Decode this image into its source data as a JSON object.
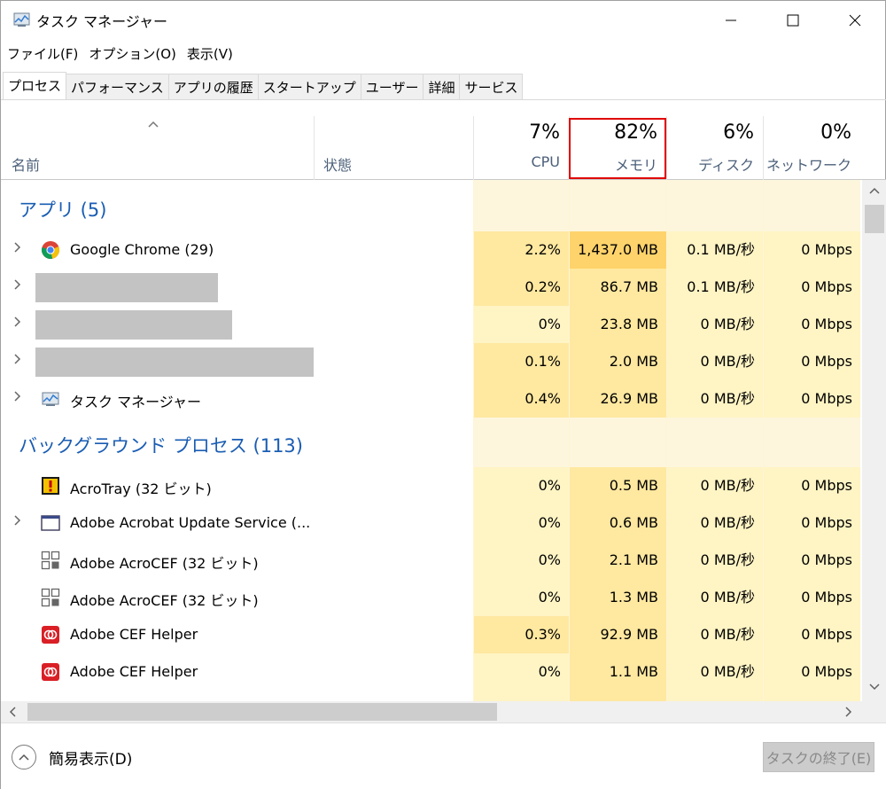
{
  "window": {
    "title": "タスク マネージャー",
    "icon": "task-manager-icon",
    "controls": {
      "minimize": "─",
      "maximize": "☐",
      "close": "✕"
    }
  },
  "menu": [
    "ファイル(F)",
    "オプション(O)",
    "表示(V)"
  ],
  "tabs": [
    {
      "label": "プロセス",
      "active": true
    },
    {
      "label": "パフォーマンス",
      "active": false
    },
    {
      "label": "アプリの履歴",
      "active": false
    },
    {
      "label": "スタートアップ",
      "active": false
    },
    {
      "label": "ユーザー",
      "active": false
    },
    {
      "label": "詳細",
      "active": false
    },
    {
      "label": "サービス",
      "active": false
    }
  ],
  "header": {
    "sort_arrow": "^",
    "name": "名前",
    "status": "状態",
    "cpu": {
      "pct": "7%",
      "label": "CPU"
    },
    "memory": {
      "pct": "82%",
      "label": "メモリ"
    },
    "disk": {
      "pct": "6%",
      "label": "ディスク"
    },
    "network": {
      "pct": "0%",
      "label": "ネットワーク"
    }
  },
  "groups": {
    "apps": "アプリ (5)",
    "background": "バックグラウンド プロセス (113)"
  },
  "apps": [
    {
      "name": "Google Chrome (29)",
      "icon": "chrome-icon",
      "expandable": true,
      "cpu": "2.2%",
      "mem": "1,437.0 MB",
      "disk": "0.1 MB/秒",
      "net": "0 Mbps"
    },
    {
      "name": "",
      "redacted": true,
      "expandable": true,
      "cpu": "0.2%",
      "mem": "86.7 MB",
      "disk": "0.1 MB/秒",
      "net": "0 Mbps"
    },
    {
      "name": "",
      "redacted": true,
      "expandable": true,
      "cpu": "0%",
      "mem": "23.8 MB",
      "disk": "0 MB/秒",
      "net": "0 Mbps"
    },
    {
      "name": "",
      "redacted": true,
      "expandable": true,
      "cpu": "0.1%",
      "mem": "2.0 MB",
      "disk": "0 MB/秒",
      "net": "0 Mbps"
    },
    {
      "name": "タスク マネージャー",
      "icon": "task-manager-icon",
      "expandable": true,
      "cpu": "0.4%",
      "mem": "26.9 MB",
      "disk": "0 MB/秒",
      "net": "0 Mbps"
    }
  ],
  "background": [
    {
      "name": "AcroTray (32 ビット)",
      "icon": "acrotray-icon",
      "expandable": false,
      "cpu": "0%",
      "mem": "0.5 MB",
      "disk": "0 MB/秒",
      "net": "0 Mbps"
    },
    {
      "name": "Adobe Acrobat Update Service (...",
      "icon": "service-window-icon",
      "expandable": true,
      "cpu": "0%",
      "mem": "0.6 MB",
      "disk": "0 MB/秒",
      "net": "0 Mbps"
    },
    {
      "name": "Adobe AcroCEF (32 ビット)",
      "icon": "acrocef-icon",
      "expandable": false,
      "cpu": "0%",
      "mem": "2.1 MB",
      "disk": "0 MB/秒",
      "net": "0 Mbps"
    },
    {
      "name": "Adobe AcroCEF (32 ビット)",
      "icon": "acrocef-icon",
      "expandable": false,
      "cpu": "0%",
      "mem": "1.3 MB",
      "disk": "0 MB/秒",
      "net": "0 Mbps"
    },
    {
      "name": "Adobe CEF Helper",
      "icon": "adobe-cc-icon",
      "expandable": false,
      "cpu": "0.3%",
      "mem": "92.9 MB",
      "disk": "0 MB/秒",
      "net": "0 Mbps"
    },
    {
      "name": "Adobe CEF Helper",
      "icon": "adobe-cc-icon",
      "expandable": false,
      "cpu": "0%",
      "mem": "1.1 MB",
      "disk": "0 MB/秒",
      "net": "0 Mbps"
    }
  ],
  "footer": {
    "fewer_details": "簡易表示(D)",
    "end_task": "タスクの終了(E)"
  },
  "colors": {
    "highlight_border": "#e00000",
    "group_title": "#1a5db3",
    "heat_low": "#fff4c4",
    "heat_mid": "#ffe8a0",
    "heat_high": "#ffd36b"
  }
}
